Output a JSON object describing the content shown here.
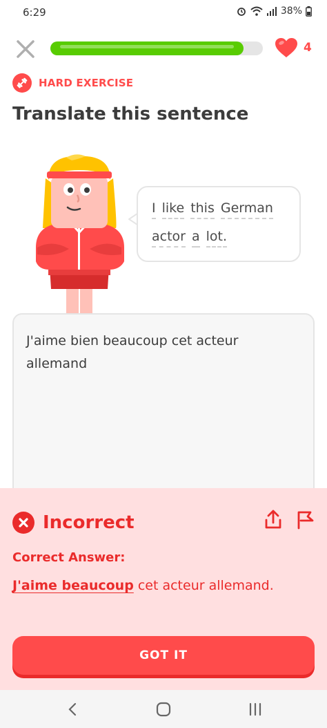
{
  "status_bar": {
    "time": "6:29",
    "battery": "38%"
  },
  "session": {
    "progress": 0.91,
    "hearts": "4"
  },
  "header": {
    "badge": "HARD EXERCISE",
    "title": "Translate this sentence"
  },
  "prompt": {
    "line1": [
      "I",
      "like",
      "this",
      "German"
    ],
    "line2": [
      "actor",
      "a",
      "lot."
    ]
  },
  "answer": {
    "text": "J'aime bien beaucoup cet acteur allemand"
  },
  "feedback": {
    "title": "Incorrect",
    "correct_label": "Correct Answer:",
    "correct_highlight": "J'aime beaucoup",
    "correct_rest": " cet acteur allemand.",
    "button": "GOT IT"
  },
  "colors": {
    "accent_red": "#ff4b4b",
    "dark_red": "#ea2b2b",
    "progress_green": "#58cc02",
    "feedback_bg": "#ffdfe0"
  },
  "icons": [
    "close-icon",
    "heart-icon",
    "dumbbell-icon",
    "incorrect-x-icon",
    "share-icon",
    "flag-icon",
    "back-nav-icon",
    "home-nav-icon",
    "recents-nav-icon"
  ]
}
